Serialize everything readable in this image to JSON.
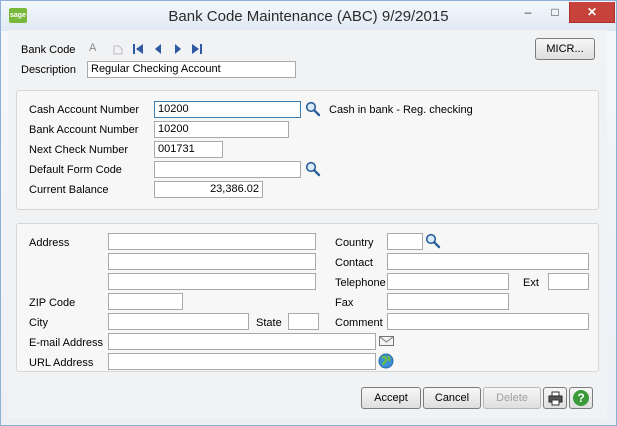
{
  "window": {
    "title": "Bank Code Maintenance (ABC) 9/29/2015",
    "logo_text": "sage",
    "minimize_glyph": "–",
    "maximize_glyph": "□",
    "close_glyph": "✕"
  },
  "header": {
    "bank_code_label": "Bank Code",
    "bank_code_value": "A",
    "description_label": "Description",
    "description_value": "Regular Checking Account",
    "micr_button": "MICR...",
    "nav_icons": [
      "lookup-icon",
      "first-record-icon",
      "previous-record-icon",
      "next-record-icon",
      "last-record-icon"
    ]
  },
  "account": {
    "cash_account_label": "Cash Account Number",
    "cash_account_value": "10200",
    "cash_account_desc": "Cash in bank - Reg. checking",
    "bank_account_label": "Bank Account Number",
    "bank_account_value": "10200",
    "next_check_label": "Next Check Number",
    "next_check_value": "001731",
    "default_form_label": "Default Form Code",
    "default_form_value": "",
    "current_balance_label": "Current Balance",
    "current_balance_value": "23,386.02"
  },
  "address": {
    "address_label": "Address",
    "zip_label": "ZIP Code",
    "city_label": "City",
    "state_label": "State",
    "email_label": "E-mail Address",
    "url_label": "URL Address",
    "country_label": "Country",
    "contact_label": "Contact",
    "telephone_label": "Telephone",
    "ext_label": "Ext",
    "fax_label": "Fax",
    "comment_label": "Comment"
  },
  "footer": {
    "accept": "Accept",
    "cancel": "Cancel",
    "delete": "Delete",
    "help_glyph": "?"
  },
  "colors": {
    "accent": "#3c7fb1",
    "close_red": "#c7423a",
    "help_green": "#3a9a3a"
  }
}
